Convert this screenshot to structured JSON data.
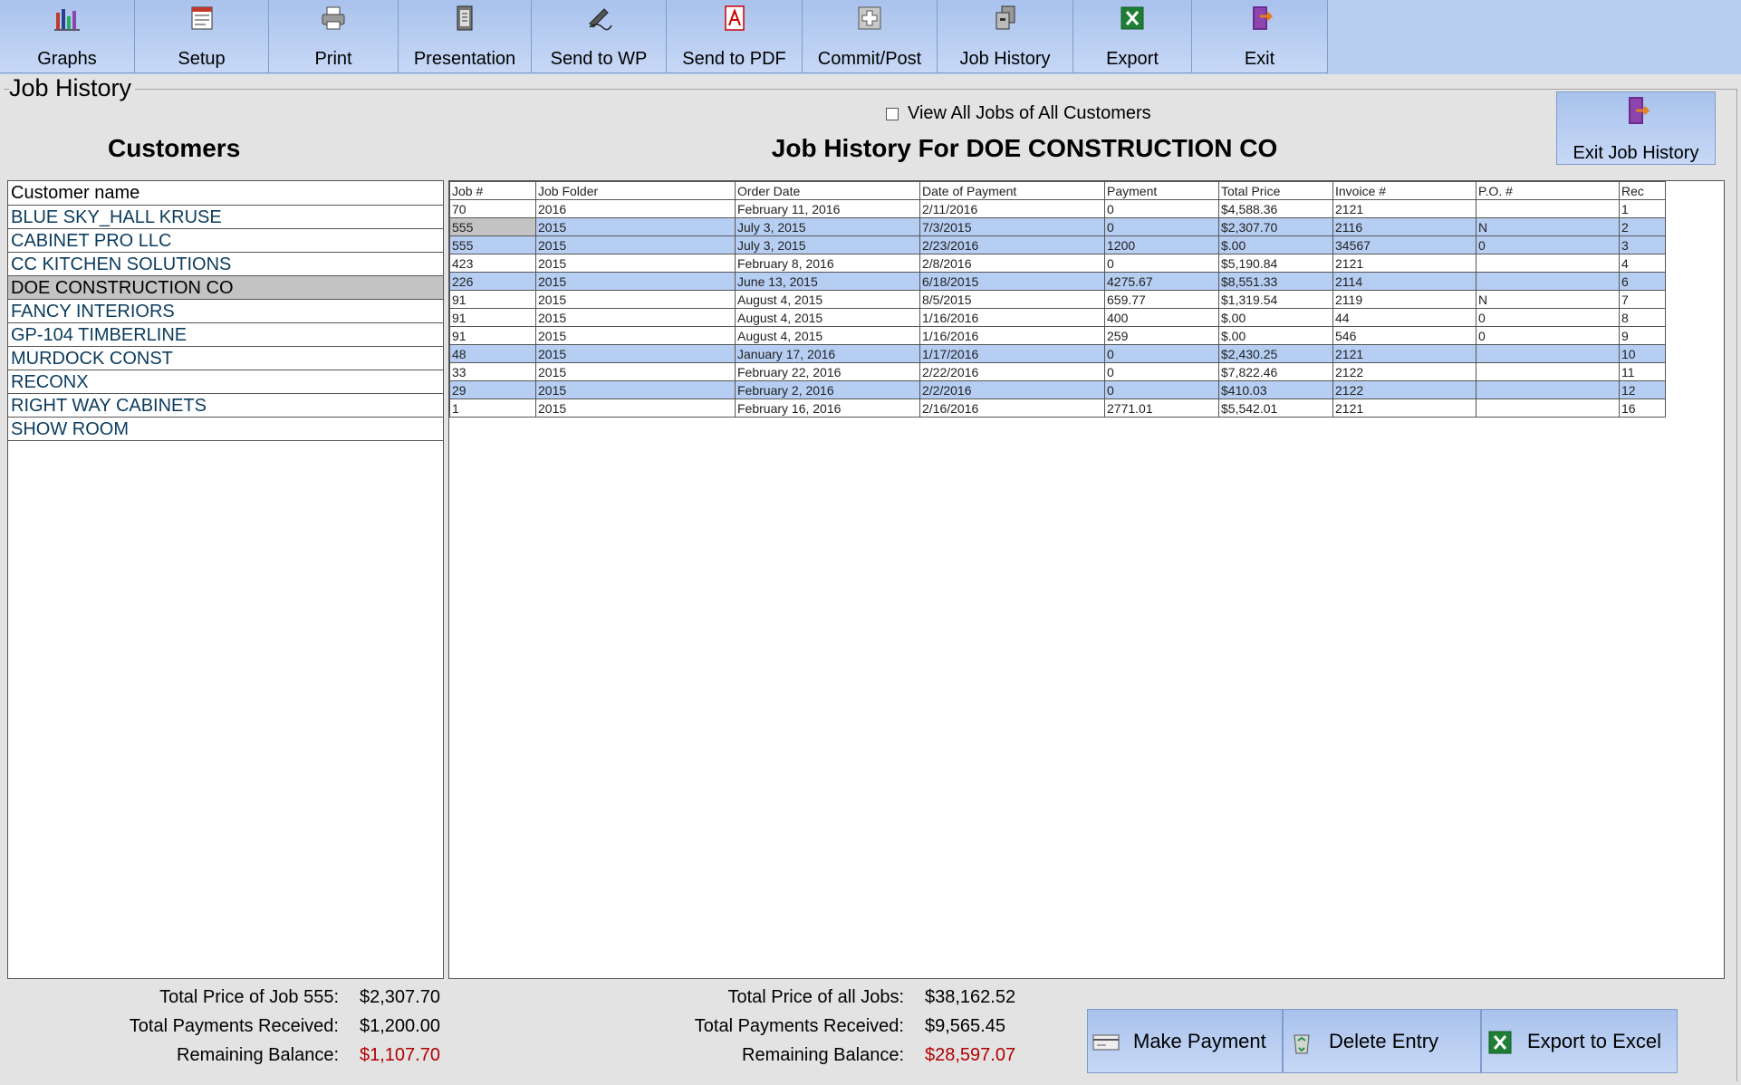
{
  "toolbar": {
    "buttons": [
      {
        "label": "Graphs",
        "icon": "bar-chart-icon"
      },
      {
        "label": "Setup",
        "icon": "setup-form-icon"
      },
      {
        "label": "Print",
        "icon": "printer-icon"
      },
      {
        "label": "Presentation",
        "icon": "notebook-icon"
      },
      {
        "label": "Send to WP",
        "icon": "pen-sign-icon"
      },
      {
        "label": "Send to PDF",
        "icon": "pdf-icon"
      },
      {
        "label": "Commit/Post",
        "icon": "plus-box-icon"
      },
      {
        "label": "Job History",
        "icon": "archive-icon"
      },
      {
        "label": "Export",
        "icon": "excel-icon"
      },
      {
        "label": "Exit",
        "icon": "exit-door-icon"
      }
    ]
  },
  "section_title": "Job History",
  "customers_heading": "Customers",
  "view_all_label": "View All Jobs of All Customers",
  "view_all_checked": false,
  "job_history_heading": "Job History For DOE CONSTRUCTION CO",
  "exit_job_history_label": "Exit Job History",
  "customers": {
    "header": "Customer name",
    "items": [
      "BLUE SKY_HALL KRUSE",
      "CABINET PRO LLC",
      "CC KITCHEN SOLUTIONS",
      "DOE CONSTRUCTION CO",
      "FANCY INTERIORS",
      "GP-104 TIMBERLINE",
      "MURDOCK CONST",
      "RECONX",
      "RIGHT WAY CABINETS",
      "SHOW ROOM"
    ],
    "selected": "DOE CONSTRUCTION CO"
  },
  "jobs": {
    "columns": [
      "Job #",
      "Job Folder",
      "Order Date",
      "Date of Payment",
      "Payment",
      "Total Price",
      "Invoice #",
      "P.O. #",
      "Rec"
    ],
    "rows": [
      [
        "70",
        "2016",
        "February 11, 2016",
        "2/11/2016",
        "0",
        "$4,588.36",
        "2121",
        "",
        "1"
      ],
      [
        "555",
        "2015",
        "July 3, 2015",
        "7/3/2015",
        "0",
        "$2,307.70",
        "2116",
        "N",
        "2"
      ],
      [
        "555",
        "2015",
        "July 3, 2015",
        "2/23/2016",
        "1200",
        "$.00",
        "34567",
        "0",
        "3"
      ],
      [
        "423",
        "2015",
        "February 8, 2016",
        "2/8/2016",
        "0",
        "$5,190.84",
        "2121",
        "",
        "4"
      ],
      [
        "226",
        "2015",
        "June 13, 2015",
        "6/18/2015",
        "4275.67",
        "$8,551.33",
        "2114",
        "",
        "6"
      ],
      [
        "91",
        "2015",
        "August 4, 2015",
        "8/5/2015",
        "659.77",
        "$1,319.54",
        "2119",
        "N",
        "7"
      ],
      [
        "91",
        "2015",
        "August 4, 2015",
        "1/16/2016",
        "400",
        "$.00",
        "44",
        "0",
        "8"
      ],
      [
        "91",
        "2015",
        "August 4, 2015",
        "1/16/2016",
        "259",
        "$.00",
        "546",
        "0",
        "9"
      ],
      [
        "48",
        "2015",
        "January 17, 2016",
        "1/17/2016",
        "0",
        "$2,430.25",
        "2121",
        "",
        "10"
      ],
      [
        "33",
        "2015",
        "February 22, 2016",
        "2/22/2016",
        "0",
        "$7,822.46",
        "2122",
        "",
        "11"
      ],
      [
        "29",
        "2015",
        "February 2, 2016",
        "2/2/2016",
        "0",
        "$410.03",
        "2122",
        "",
        "12"
      ],
      [
        "1",
        "2015",
        "February 16, 2016",
        "2/16/2016",
        "2771.01",
        "$5,542.01",
        "2121",
        "",
        "16"
      ]
    ],
    "highlighted_rows": [
      1,
      2,
      4,
      8,
      10
    ],
    "selected_row": 1
  },
  "totals_job": {
    "price_label": "Total Price of Job 555:",
    "price": "$2,307.70",
    "payments_label": "Total Payments Received:",
    "payments": "$1,200.00",
    "balance_label": "Remaining Balance:",
    "balance": "$1,107.70"
  },
  "totals_all": {
    "price_label": "Total Price of all Jobs:",
    "price": "$38,162.52",
    "payments_label": "Total Payments Received:",
    "payments": "$9,565.45",
    "balance_label": "Remaining Balance:",
    "balance": "$28,597.07"
  },
  "actions": {
    "make_payment": "Make Payment",
    "delete_entry": "Delete Entry",
    "export_excel": "Export to Excel"
  },
  "colors": {
    "toolbar_bg": "#b6cdf0",
    "row_highlight": "#b7cef3",
    "selection_gray": "#c3c3c3",
    "balance_red": "#b20000"
  }
}
